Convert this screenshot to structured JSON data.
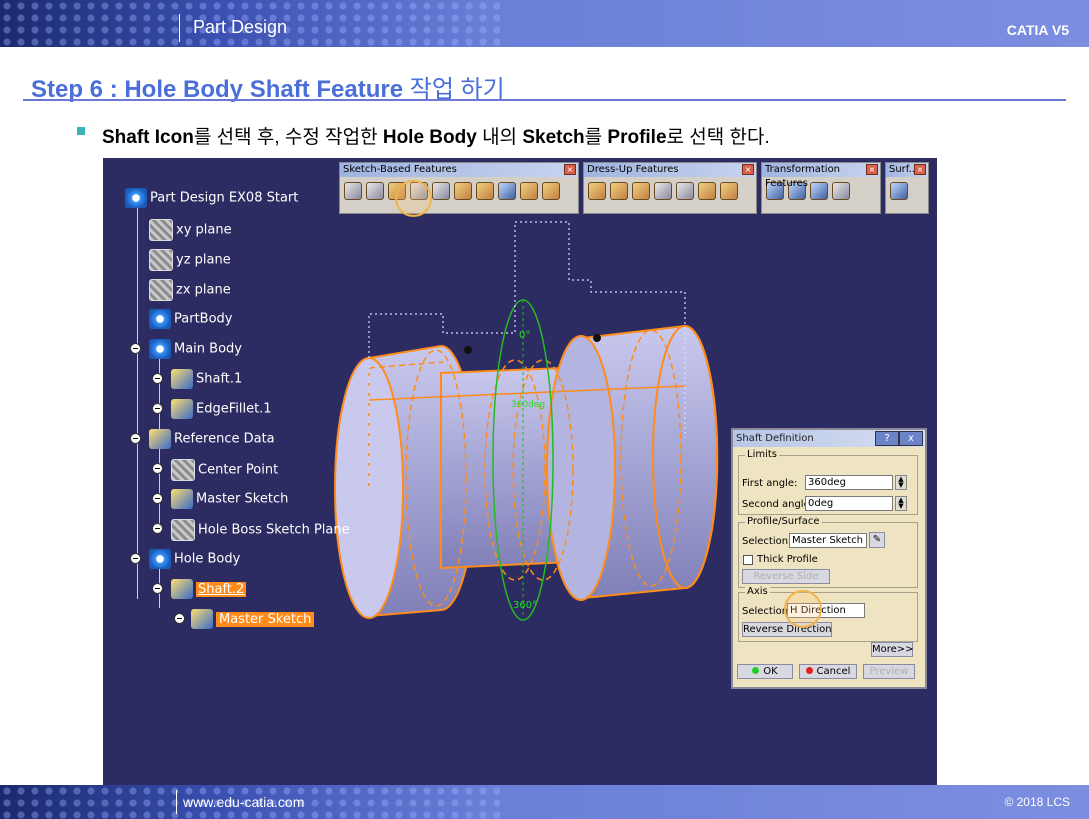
{
  "header": {
    "title": "Part Design",
    "brand": "CATIA V5"
  },
  "step_title": {
    "en": "Step 6 : Hole Body Shaft Feature",
    "kr": "작업 하기"
  },
  "instruction": {
    "p1": "Shaft Icon",
    "p2": "를 선택 후, 수정 작업한",
    "p3": "Hole Body",
    "p4": "내의",
    "p5": "Sketch",
    "p6": "를",
    "p7": "Profile",
    "p8": "로 선택 한다."
  },
  "toolbars": [
    {
      "name": "Sketch-Based Features"
    },
    {
      "name": "Dress-Up Features"
    },
    {
      "name": "Transformation Features"
    },
    {
      "name": "Surf..."
    }
  ],
  "tree": {
    "root": "Part Design EX08 Start",
    "items": [
      "xy plane",
      "yz plane",
      "zx plane",
      "PartBody",
      "Main Body",
      "Shaft.1",
      "EdgeFillet.1",
      "Reference Data",
      "Center Point",
      "Master Sketch",
      "Hole Boss Sketch Plane",
      "Hole Body",
      "Shaft.2",
      "Master Sketch"
    ]
  },
  "viewport": {
    "angle_top": "0°",
    "angle_bottom": "360°",
    "angle_mid": "360deg"
  },
  "dialog": {
    "title": "Shaft Definition",
    "help": "?",
    "close": "x",
    "limits_label": "Limits",
    "first_angle_label": "First angle:",
    "first_angle_value": "360deg",
    "second_angle_label": "Second angle:",
    "second_angle_value": "0deg",
    "profile_label": "Profile/Surface",
    "profile_selection_label": "Selection:",
    "profile_selection_value": "Master Sketch",
    "thick_profile_label": "Thick Profile",
    "reverse_side": "Reverse Side",
    "axis_label": "Axis",
    "axis_selection_label": "Selection:",
    "axis_selection_value": "H Direction",
    "reverse_direction": "Reverse Direction",
    "more": "More>>",
    "ok": "OK",
    "cancel": "Cancel",
    "preview": "Preview"
  },
  "footer": {
    "url": "www.edu-catia.com",
    "copyright": "© 2018 LCS"
  },
  "colors": {
    "accent_blue": "#4a6fd8",
    "viewport_bg": "#2c2c63",
    "highlight_orange": "#ff8c1a",
    "bullet_teal": "#3ab3b8"
  }
}
